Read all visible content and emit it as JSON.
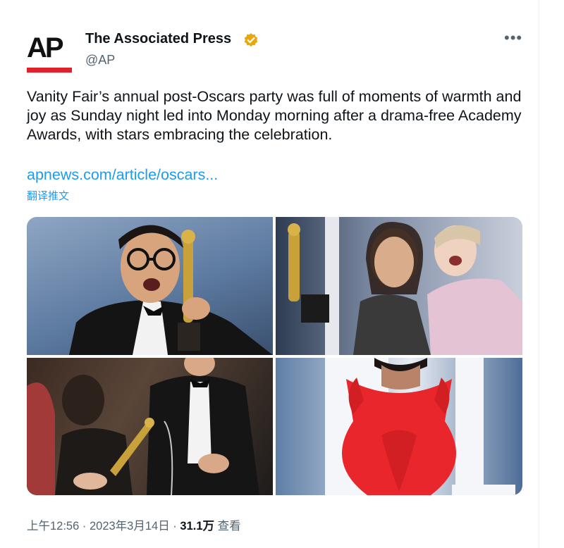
{
  "author": {
    "logo_text": "AP",
    "display_name": "The Associated Press",
    "handle": "@AP",
    "verified_icon": "verified-badge-icon",
    "more_label": "•••"
  },
  "tweet": {
    "text": "Vanity Fair’s annual post-Oscars party was full of moments of warmth and joy as Sunday night led into Monday morning after a drama-free Academy Awards, with stars embracing the celebration.",
    "link": "apnews.com/article/oscars...",
    "translate": "翻译推文"
  },
  "media": {
    "photos": [
      {
        "name": "photo-man-with-oscar"
      },
      {
        "name": "photo-women-with-oscar"
      },
      {
        "name": "photo-oscar-engraving"
      },
      {
        "name": "photo-woman-red-dress"
      }
    ]
  },
  "meta": {
    "time": "上午12:56",
    "separator": " · ",
    "date": "2023年3月14日",
    "views_count": "31.1万",
    "views_label": " 查看"
  },
  "colors": {
    "accent": "#1d9bf0",
    "ap_red": "#e0222a",
    "verified_gold": "#e8a80c"
  }
}
